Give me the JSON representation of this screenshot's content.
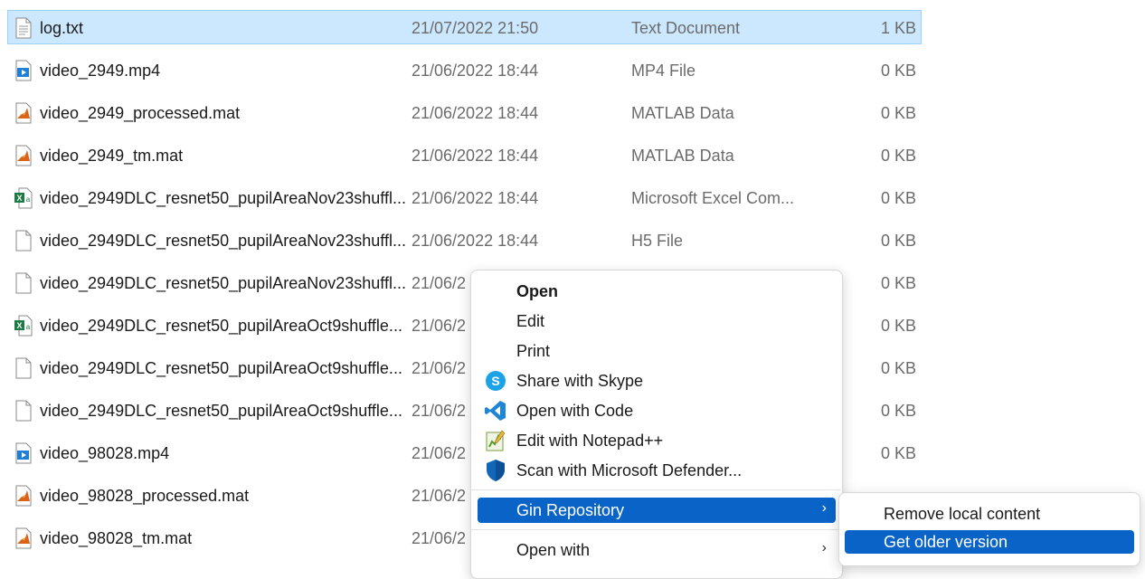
{
  "files": [
    {
      "name": "log.txt",
      "date": "21/07/2022 21:50",
      "type": "Text Document",
      "size": "1 KB",
      "icon": "text-file-icon",
      "selected": true
    },
    {
      "name": "video_2949.mp4",
      "date": "21/06/2022 18:44",
      "type": "MP4 File",
      "size": "0 KB",
      "icon": "video-file-icon"
    },
    {
      "name": "video_2949_processed.mat",
      "date": "21/06/2022 18:44",
      "type": "MATLAB Data",
      "size": "0 KB",
      "icon": "matlab-file-icon"
    },
    {
      "name": "video_2949_tm.mat",
      "date": "21/06/2022 18:44",
      "type": "MATLAB Data",
      "size": "0 KB",
      "icon": "matlab-file-icon"
    },
    {
      "name": "video_2949DLC_resnet50_pupilAreaNov23shuffl...",
      "date": "21/06/2022 18:44",
      "type": "Microsoft Excel Com...",
      "size": "0 KB",
      "icon": "excel-file-icon"
    },
    {
      "name": "video_2949DLC_resnet50_pupilAreaNov23shuffl...",
      "date": "21/06/2022 18:44",
      "type": "H5 File",
      "size": "0 KB",
      "icon": "blank-file-icon"
    },
    {
      "name": "video_2949DLC_resnet50_pupilAreaNov23shuffl...",
      "date": "21/06/2",
      "type": "",
      "size": "0 KB",
      "icon": "blank-file-icon"
    },
    {
      "name": "video_2949DLC_resnet50_pupilAreaOct9shuffle...",
      "date": "21/06/2",
      "type": "",
      "size": "0 KB",
      "icon": "excel-file-icon"
    },
    {
      "name": "video_2949DLC_resnet50_pupilAreaOct9shuffle...",
      "date": "21/06/2",
      "type": "",
      "size": "0 KB",
      "icon": "blank-file-icon"
    },
    {
      "name": "video_2949DLC_resnet50_pupilAreaOct9shuffle...",
      "date": "21/06/2",
      "type": "",
      "size": "0 KB",
      "icon": "blank-file-icon"
    },
    {
      "name": "video_98028.mp4",
      "date": "21/06/2",
      "type": "",
      "size": "0 KB",
      "icon": "video-file-icon"
    },
    {
      "name": "video_98028_processed.mat",
      "date": "21/06/2",
      "type": "",
      "size": "",
      "icon": "matlab-file-icon"
    },
    {
      "name": "video_98028_tm.mat",
      "date": "21/06/2",
      "type": "",
      "size": "",
      "icon": "matlab-file-icon"
    }
  ],
  "context_menu": {
    "items": [
      {
        "label": "Open",
        "icon": "",
        "bold": true
      },
      {
        "label": "Edit",
        "icon": ""
      },
      {
        "label": "Print",
        "icon": ""
      },
      {
        "label": "Share with Skype",
        "icon": "skype-icon"
      },
      {
        "label": "Open with Code",
        "icon": "vscode-icon"
      },
      {
        "label": "Edit with Notepad++",
        "icon": "notepadpp-icon"
      },
      {
        "label": "Scan with Microsoft Defender...",
        "icon": "defender-shield-icon"
      },
      {
        "label": "Gin Repository",
        "icon": "",
        "submenu": true,
        "highlighted": true
      },
      {
        "label": "Open with",
        "icon": "",
        "submenu": true
      }
    ]
  },
  "submenu": {
    "items": [
      {
        "label": "Remove local content"
      },
      {
        "label": "Get older version",
        "highlighted": true
      }
    ]
  },
  "colors": {
    "selection_bg": "#cce8ff",
    "selection_border": "#99d1ff",
    "menu_highlight": "#0a64c8"
  }
}
